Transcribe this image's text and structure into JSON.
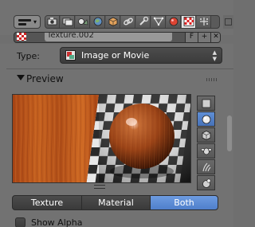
{
  "toolbar": {
    "editor_type_icon": "properties-editor-icon",
    "contexts": [
      {
        "name": "render-icon",
        "active": false
      },
      {
        "name": "render-layers-icon",
        "active": false
      },
      {
        "name": "scene-icon",
        "active": false
      },
      {
        "name": "world-icon",
        "active": false
      },
      {
        "name": "object-icon",
        "active": false
      },
      {
        "name": "constraints-icon",
        "active": false
      },
      {
        "name": "modifiers-icon",
        "active": false
      },
      {
        "name": "mesh-data-icon",
        "active": false
      },
      {
        "name": "material-icon",
        "active": false
      },
      {
        "name": "texture-icon",
        "active": true
      },
      {
        "name": "particles-icon",
        "active": false
      }
    ]
  },
  "datablock": {
    "name": "Texture.002",
    "fake_user_icon": "fake-user-icon",
    "close_icon": "close-icon"
  },
  "type_field": {
    "label": "Type:",
    "value": "Image or Movie",
    "icon": "image-texture-icon"
  },
  "preview_panel": {
    "title": "Preview",
    "shapes": [
      {
        "name": "plane-icon",
        "active": false
      },
      {
        "name": "sphere-icon",
        "active": true
      },
      {
        "name": "cube-icon",
        "active": false
      },
      {
        "name": "monkey-icon",
        "active": false
      },
      {
        "name": "hair-icon",
        "active": false
      },
      {
        "name": "world-sphere-icon",
        "active": false
      }
    ],
    "modes": [
      {
        "label": "Texture",
        "active": false
      },
      {
        "label": "Material",
        "active": false
      },
      {
        "label": "Both",
        "active": true
      }
    ],
    "show_alpha": {
      "label": "Show Alpha",
      "checked": false
    }
  },
  "colors": {
    "panel_bg": "#727272",
    "active_blue": "#5680cb",
    "wood": "#b5541c"
  }
}
